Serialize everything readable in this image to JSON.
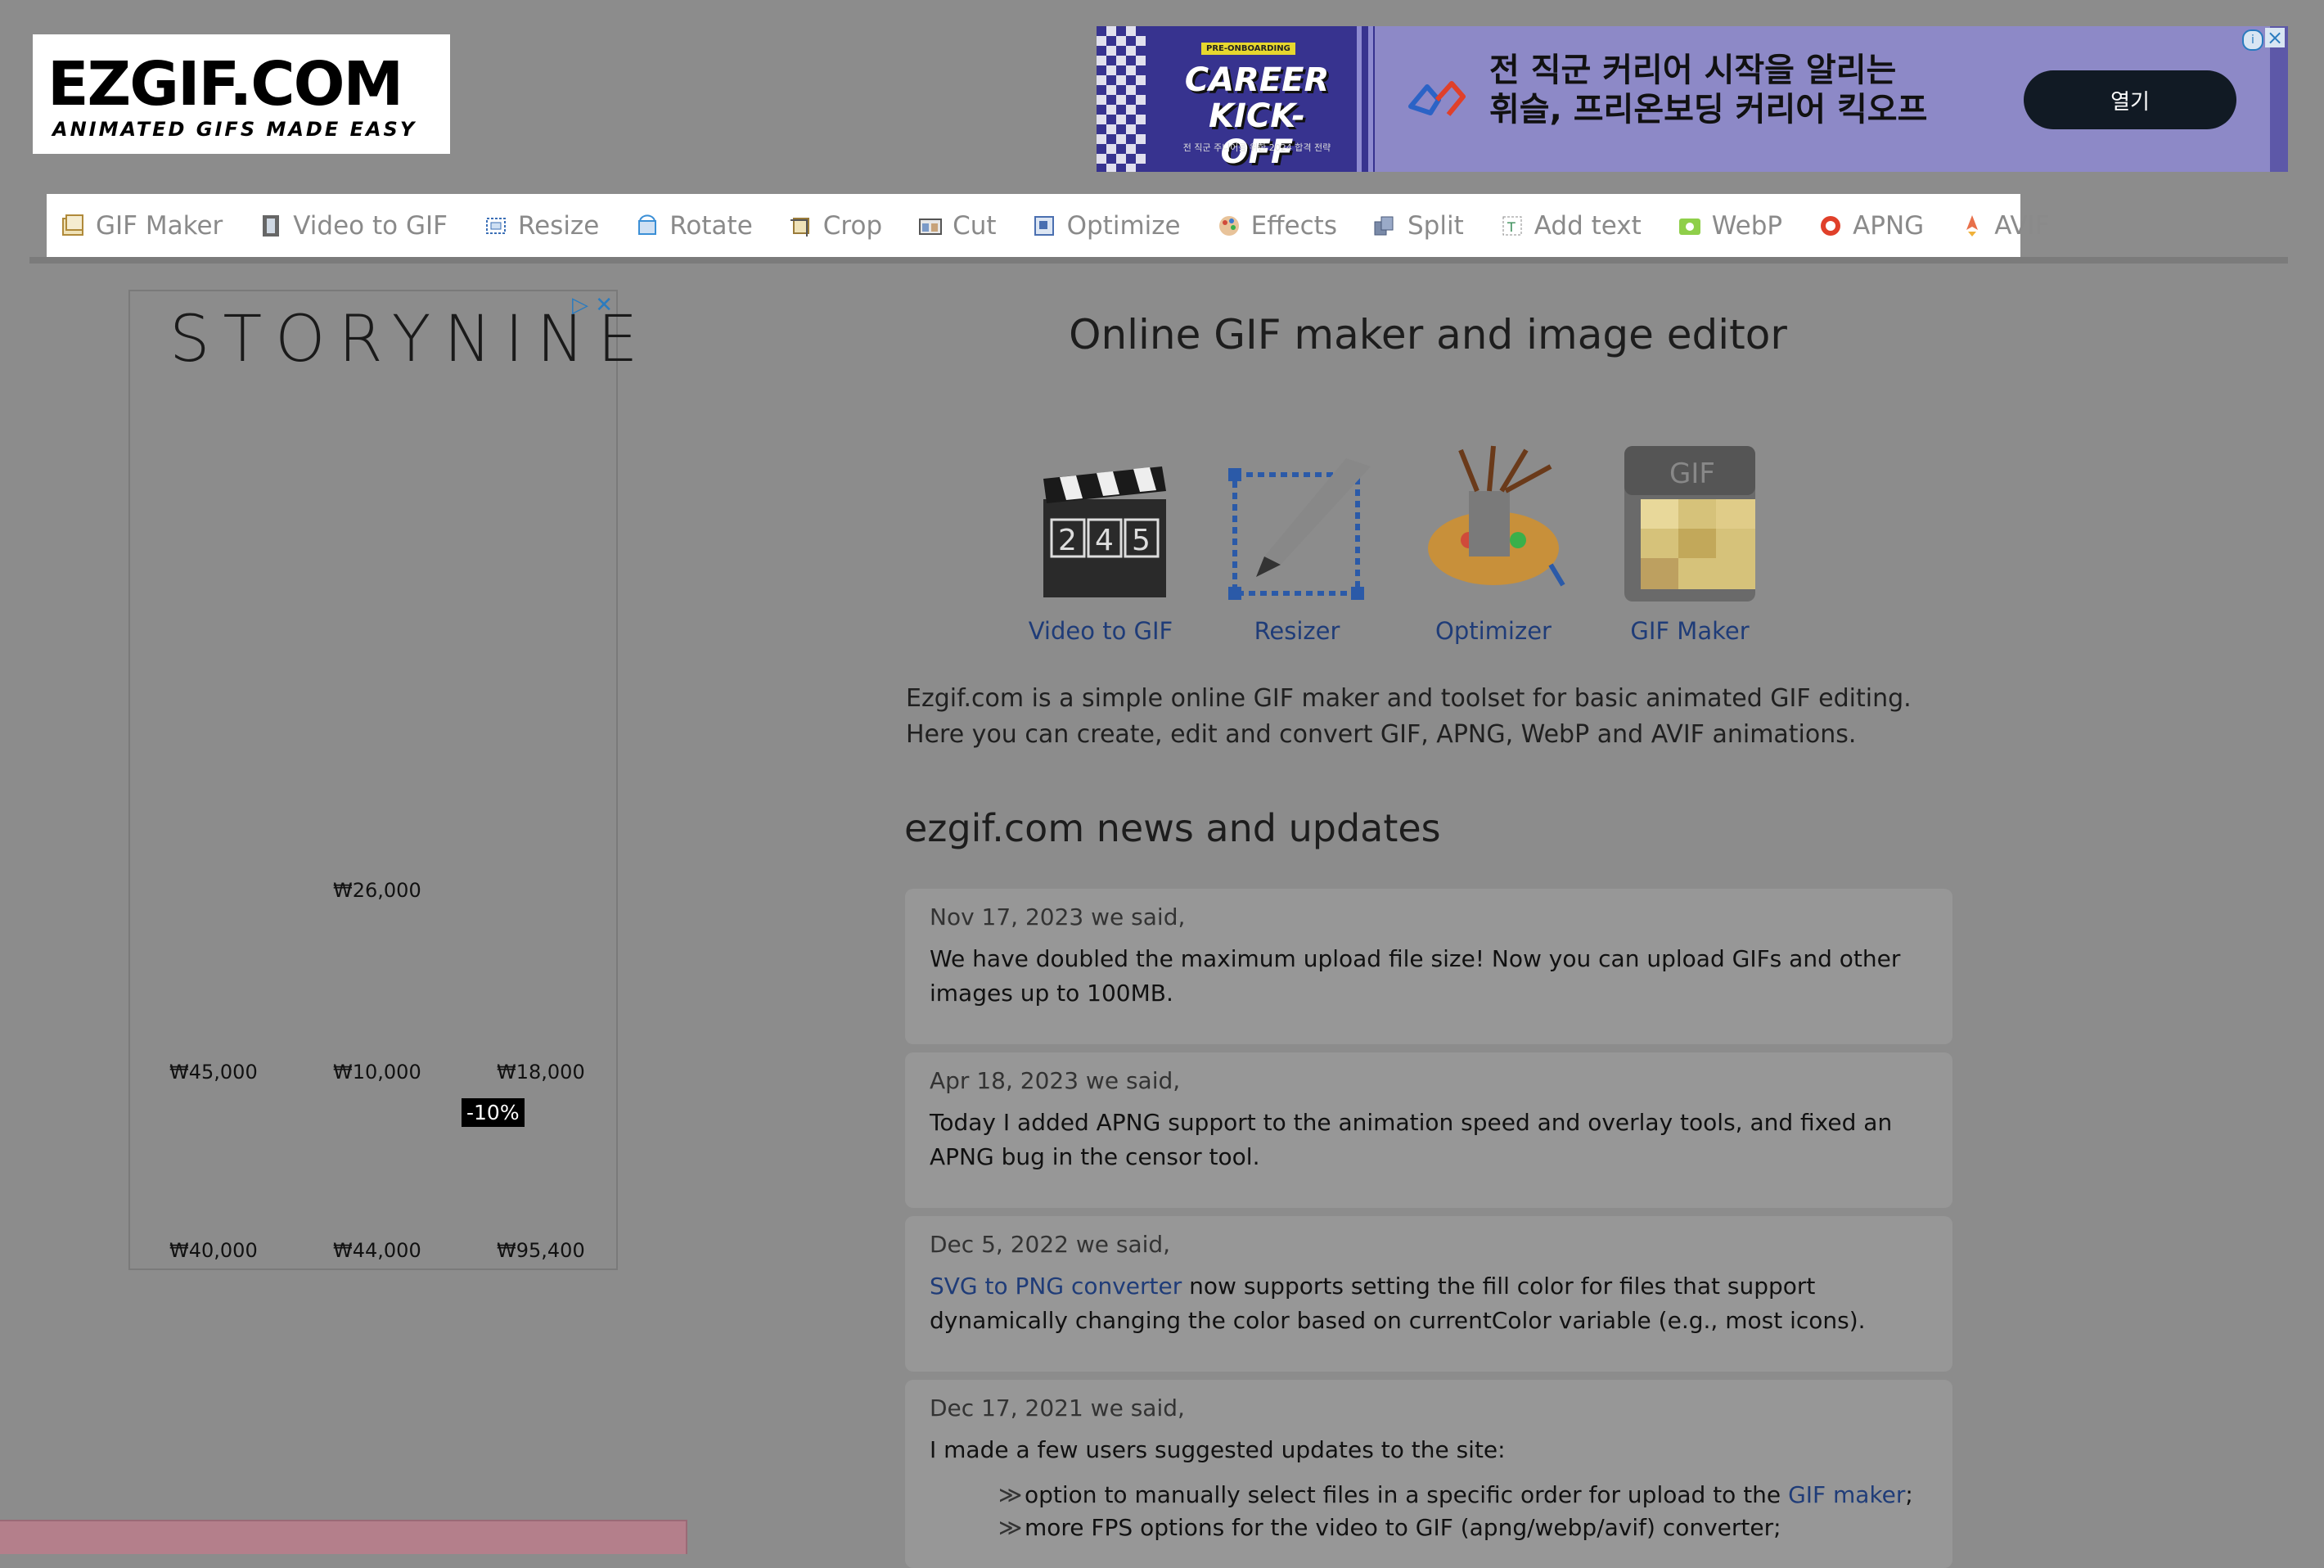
{
  "logo": {
    "main": "EZGIF.COM",
    "tagline": "ANIMATED GIFS MADE EASY"
  },
  "top_ad": {
    "tag": "PRE-ONBOARDING",
    "title_line1": "CAREER",
    "title_line2": "KICK-OFF",
    "small": "전 직군 주니어를 위한 2024 합격 전략",
    "text_line1": "전 직군 커리어 시작을 알리는",
    "text_line2": "휘슬, 프리온보딩 커리어 킥오프",
    "button": "열기"
  },
  "nav": {
    "items": [
      {
        "label": "GIF Maker",
        "icon": "gif-maker-icon",
        "color": "#c9a86a"
      },
      {
        "label": "Video to GIF",
        "icon": "film-icon",
        "color": "#555"
      },
      {
        "label": "Resize",
        "icon": "resize-icon",
        "color": "#3b6fb6"
      },
      {
        "label": "Rotate",
        "icon": "rotate-icon",
        "color": "#3b8fd6"
      },
      {
        "label": "Crop",
        "icon": "crop-icon",
        "color": "#9a7b3a"
      },
      {
        "label": "Cut",
        "icon": "cut-icon",
        "color": "#6a6a6a"
      },
      {
        "label": "Optimize",
        "icon": "optimize-icon",
        "color": "#4a6fb0"
      },
      {
        "label": "Effects",
        "icon": "effects-icon",
        "color": "#d28a3a"
      },
      {
        "label": "Split",
        "icon": "split-icon",
        "color": "#4a5a7a"
      },
      {
        "label": "Add text",
        "icon": "add-text-icon",
        "color": "#3b8f5a"
      },
      {
        "label": "WebP",
        "icon": "webp-icon",
        "color": "#7bbf3a"
      },
      {
        "label": "APNG",
        "icon": "apng-icon",
        "color": "#e0402a"
      },
      {
        "label": "AVIF",
        "icon": "avif-icon",
        "color": "#e8704a"
      }
    ]
  },
  "left_ad": {
    "brand": "STORYNINE",
    "prices": {
      "p1": "₩26,000",
      "p2": "₩45,000",
      "p3": "₩10,000",
      "p4": "₩18,000",
      "p5": "₩40,000",
      "p6": "₩44,000",
      "p7": "₩95,400"
    },
    "discount": "-10%"
  },
  "main": {
    "title": "Online GIF maker and image editor",
    "tools": [
      {
        "label": "Video to GIF"
      },
      {
        "label": "Resizer"
      },
      {
        "label": "Optimizer"
      },
      {
        "label": "GIF Maker"
      }
    ],
    "intro_line1": "Ezgif.com is a simple online GIF maker and toolset for basic animated GIF editing.",
    "intro_line2": "Here you can create, edit and convert GIF, APNG, WebP and AVIF animations.",
    "news_title": "ezgif.com news and updates"
  },
  "news": [
    {
      "date": "Nov 17, 2023 we said,",
      "body": "We have doubled the maximum upload file size! Now you can upload GIFs and other images up to 100MB."
    },
    {
      "date": "Apr 18, 2023 we said,",
      "body": "Today I added APNG support to the animation speed and overlay tools, and fixed an APNG bug in the censor tool."
    },
    {
      "date": "Dec 5, 2022 we said,",
      "link": "SVG to PNG converter",
      "body": " now supports setting the fill color for files that support dynamically changing the color based on currentColor variable (e.g., most icons)."
    },
    {
      "date": "Dec 17, 2021 we said,",
      "body": "I made a few users suggested updates to the site:",
      "bullet1_text": "option to manually select files in a specific order for upload to the ",
      "bullet1_link": "GIF maker",
      "bullet1_end": ";",
      "bullet2": "more FPS options for the video to GIF (apng/webp/avif) converter;"
    }
  ]
}
